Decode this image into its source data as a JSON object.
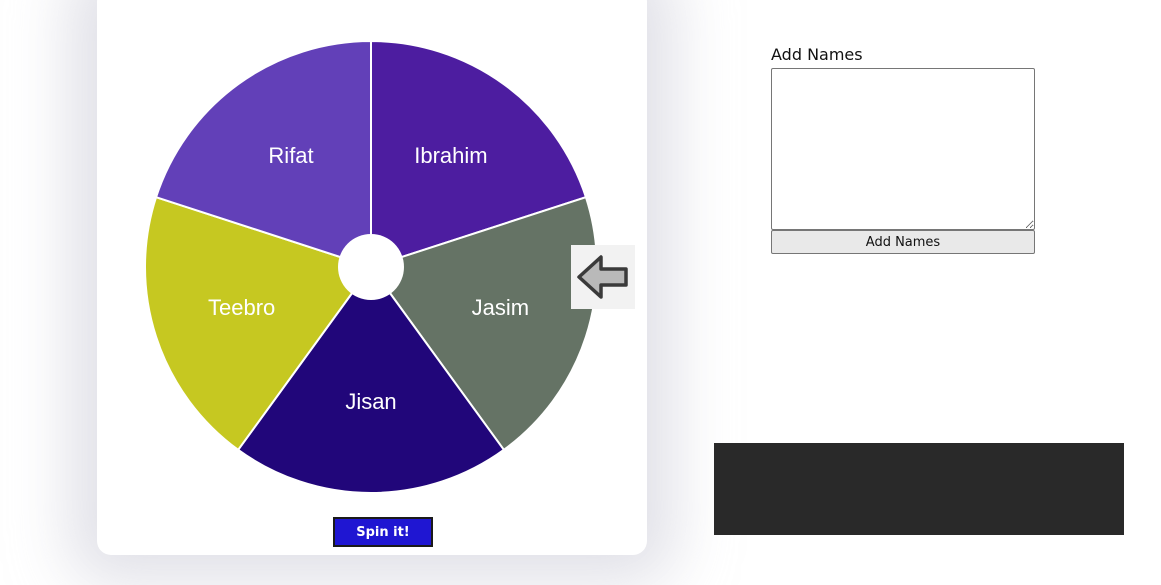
{
  "wheel": {
    "slices": [
      {
        "name": "Ibrahim",
        "color": "#4d1da0"
      },
      {
        "name": "Jasim",
        "color": "#657365"
      },
      {
        "name": "Jisan",
        "color": "#21067a"
      },
      {
        "name": "Teebro",
        "color": "#c6c821"
      },
      {
        "name": "Rifat",
        "color": "#6240b8"
      }
    ],
    "label_color": "#ffffff",
    "divider_color": "#ffffff",
    "hub_color": "#ffffff",
    "pointer_icon": "left-arrow-icon",
    "spin_label": "Spin it!"
  },
  "names_panel": {
    "label": "Add Names",
    "textarea_value": "",
    "button_label": "Add Names"
  },
  "result_panel": {
    "color": "#292929"
  }
}
